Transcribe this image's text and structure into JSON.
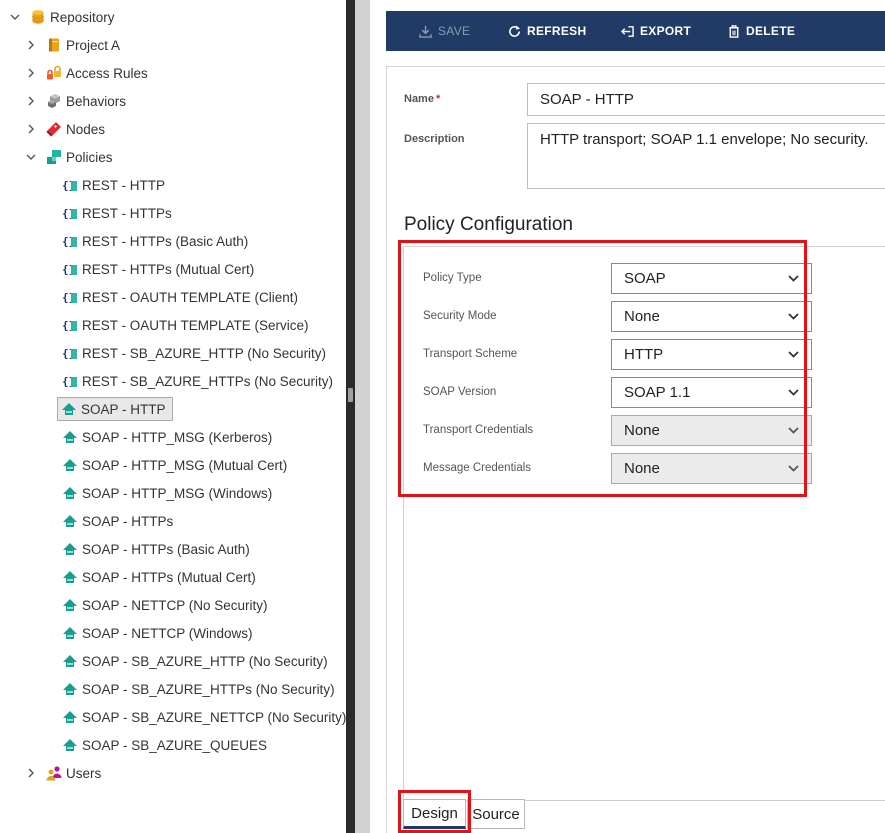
{
  "tree": {
    "root": {
      "label": "Repository",
      "icon": "database-icon"
    },
    "folders": [
      {
        "key": "project_a",
        "label": "Project A",
        "icon": "project-icon"
      },
      {
        "key": "access_rules",
        "label": "Access Rules",
        "icon": "lock-icon"
      },
      {
        "key": "behaviors",
        "label": "Behaviors",
        "icon": "cubes-icon"
      },
      {
        "key": "nodes",
        "label": "Nodes",
        "icon": "node-icon"
      },
      {
        "key": "policies",
        "label": "Policies",
        "icon": "policies-icon"
      }
    ],
    "policies": [
      {
        "label": "REST - HTTP",
        "icon": "rest-policy-icon"
      },
      {
        "label": "REST - HTTPs",
        "icon": "rest-policy-icon"
      },
      {
        "label": "REST - HTTPs (Basic Auth)",
        "icon": "rest-policy-icon"
      },
      {
        "label": "REST - HTTPs (Mutual Cert)",
        "icon": "rest-policy-icon"
      },
      {
        "label": "REST - OAUTH TEMPLATE (Client)",
        "icon": "rest-policy-icon"
      },
      {
        "label": "REST - OAUTH TEMPLATE (Service)",
        "icon": "rest-policy-icon"
      },
      {
        "label": "REST - SB_AZURE_HTTP (No Security)",
        "icon": "rest-policy-icon"
      },
      {
        "label": "REST - SB_AZURE_HTTPs (No Security)",
        "icon": "rest-policy-icon"
      },
      {
        "label": "SOAP - HTTP",
        "icon": "soap-policy-icon",
        "selected": true
      },
      {
        "label": "SOAP - HTTP_MSG (Kerberos)",
        "icon": "soap-policy-icon"
      },
      {
        "label": "SOAP - HTTP_MSG (Mutual Cert)",
        "icon": "soap-policy-icon"
      },
      {
        "label": "SOAP - HTTP_MSG (Windows)",
        "icon": "soap-policy-icon"
      },
      {
        "label": "SOAP - HTTPs",
        "icon": "soap-policy-icon"
      },
      {
        "label": "SOAP - HTTPs (Basic Auth)",
        "icon": "soap-policy-icon"
      },
      {
        "label": "SOAP - HTTPs (Mutual Cert)",
        "icon": "soap-policy-icon"
      },
      {
        "label": "SOAP - NETTCP (No Security)",
        "icon": "soap-policy-icon"
      },
      {
        "label": "SOAP - NETTCP (Windows)",
        "icon": "soap-policy-icon"
      },
      {
        "label": "SOAP - SB_AZURE_HTTP (No Security)",
        "icon": "soap-policy-icon"
      },
      {
        "label": "SOAP - SB_AZURE_HTTPs (No Security)",
        "icon": "soap-policy-icon"
      },
      {
        "label": "SOAP - SB_AZURE_NETTCP (No Security)",
        "icon": "soap-policy-icon"
      },
      {
        "label": "SOAP - SB_AZURE_QUEUES",
        "icon": "soap-policy-icon"
      }
    ],
    "users": {
      "label": "Users",
      "icon": "users-icon"
    }
  },
  "toolbar": {
    "save": {
      "label": "SAVE",
      "icon": "download-icon",
      "enabled": false
    },
    "refresh": {
      "label": "REFRESH",
      "icon": "refresh-icon"
    },
    "export": {
      "label": "EXPORT",
      "icon": "export-icon"
    },
    "delete": {
      "label": "DELETE",
      "icon": "trash-icon"
    }
  },
  "form": {
    "name_label": "Name",
    "name_required_mark": "*",
    "name_value": "SOAP - HTTP",
    "description_label": "Description",
    "description_value": "HTTP transport; SOAP 1.1 envelope; No security."
  },
  "policy_config": {
    "title": "Policy Configuration",
    "fields": [
      {
        "label": "Policy Type",
        "value": "SOAP",
        "enabled": true
      },
      {
        "label": "Security Mode",
        "value": "None",
        "enabled": true
      },
      {
        "label": "Transport Scheme",
        "value": "HTTP",
        "enabled": true
      },
      {
        "label": "SOAP Version",
        "value": "SOAP 1.1",
        "enabled": true
      },
      {
        "label": "Transport Credentials",
        "value": "None",
        "enabled": false
      },
      {
        "label": "Message Credentials",
        "value": "None",
        "enabled": false
      }
    ]
  },
  "tabs": [
    {
      "label": "Design",
      "active": true
    },
    {
      "label": "Source",
      "active": false
    }
  ],
  "colors": {
    "toolbar_bg": "#1f3b66",
    "highlight": "#e0121a",
    "policy_rest": "#2fb8a8",
    "policy_soap": "#1a9c8f"
  }
}
